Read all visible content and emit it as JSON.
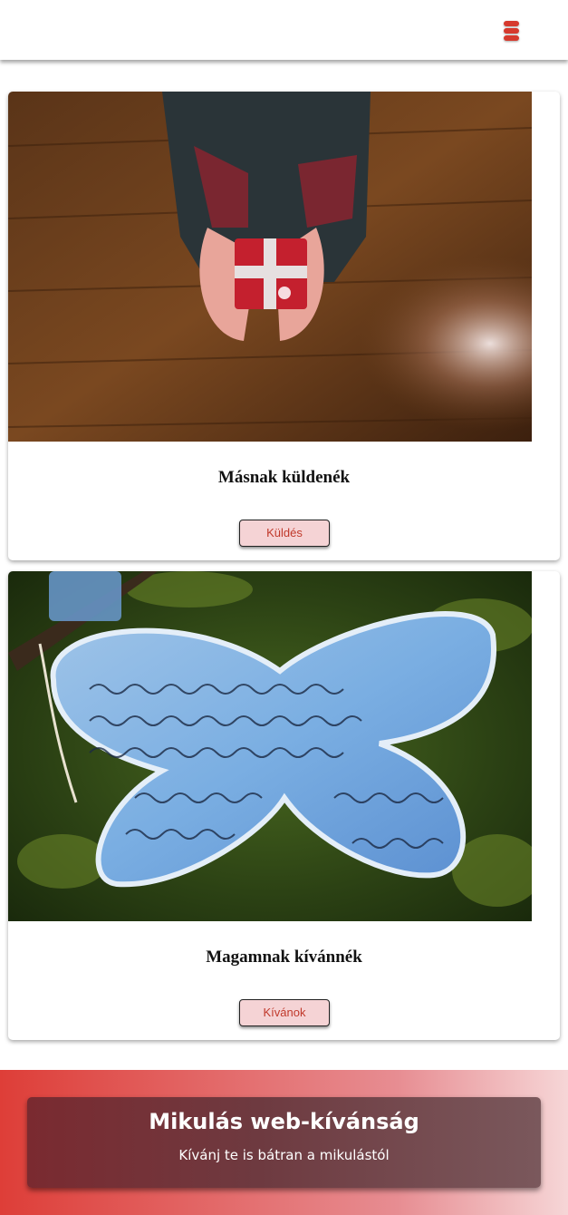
{
  "header": {
    "menu_icon": "hamburger-menu-icon",
    "accent_color": "#d63a2e"
  },
  "cards": [
    {
      "image": "hands-holding-gift-photo",
      "title": "Másnak küldenék",
      "button_label": "Küldés"
    },
    {
      "image": "butterfly-wish-note-photo",
      "title": "Magamnak kívánnék",
      "button_label": "Kívánok"
    }
  ],
  "footer": {
    "title": "Mikulás web-kívánság",
    "subtitle": "Kívánj te is bátran a mikulástól"
  }
}
